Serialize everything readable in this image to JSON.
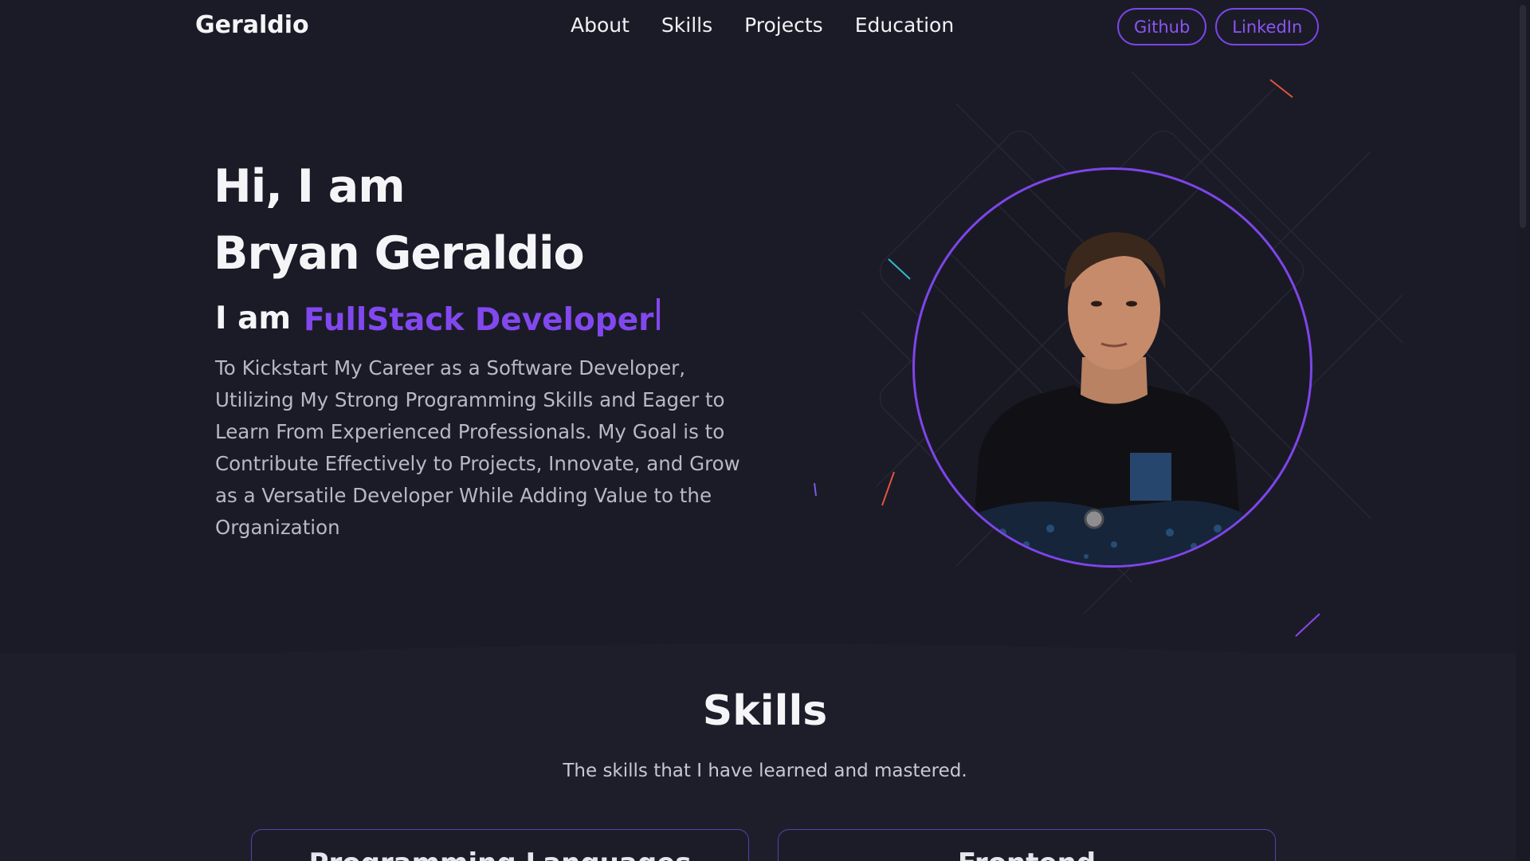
{
  "nav": {
    "brand": "Geraldio",
    "links": [
      "About",
      "Skills",
      "Projects",
      "Education"
    ],
    "github_label": "Github",
    "linkedin_label": "LinkedIn"
  },
  "hero": {
    "greeting": "Hi, I am",
    "name": "Bryan Geraldio",
    "role_prefix": "I am",
    "role": "FullStack Developer",
    "description": "To Kickstart My Career as a Software Developer, Utilizing My Strong Programming Skills and Eager to Learn From Experienced Professionals. My Goal is to Contribute Effectively to Projects, Innovate, and Grow as a Versatile Developer While Adding Value to the Organization"
  },
  "skills": {
    "title": "Skills",
    "subtitle": "The skills that I have learned and mastered.",
    "cards": [
      "Programming Languages",
      "Frontend"
    ]
  },
  "colors": {
    "background": "#1b1b27",
    "accent": "#8248ef",
    "text": "#f5f5f8",
    "muted": "#b9b9c4"
  }
}
